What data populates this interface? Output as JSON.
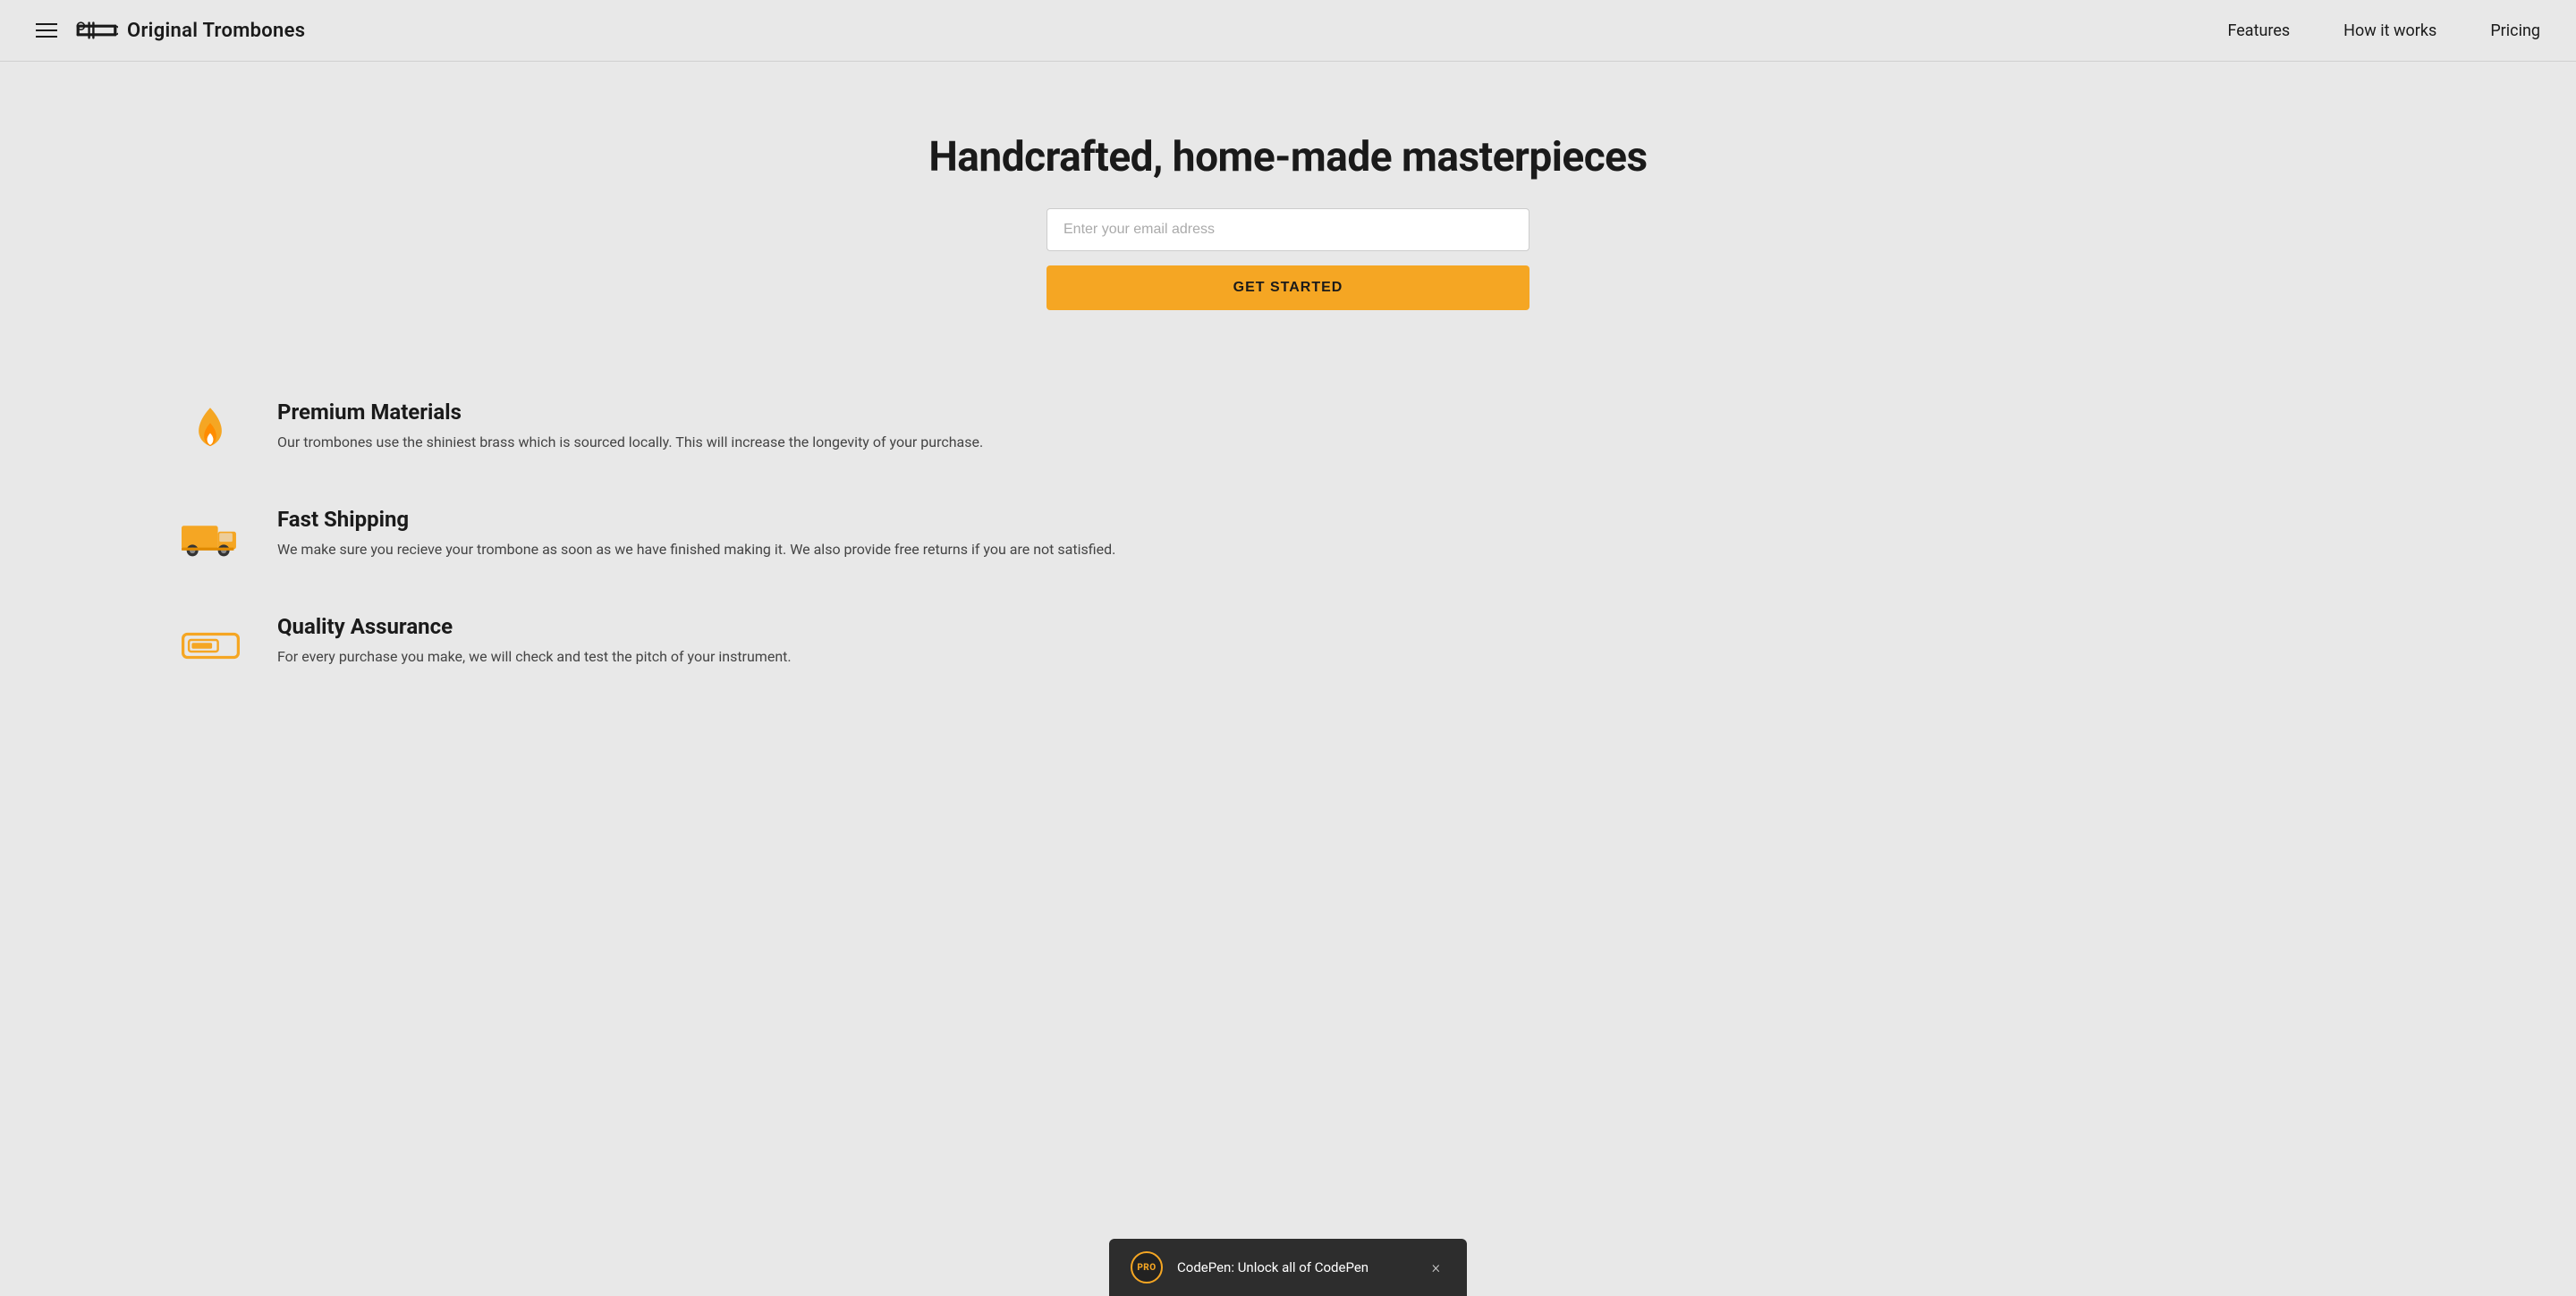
{
  "header": {
    "hamburger_label": "menu",
    "logo_text": "Original Trombones",
    "nav_items": [
      {
        "label": "Features",
        "href": "#features"
      },
      {
        "label": "How it works",
        "href": "#how-it-works"
      },
      {
        "label": "Pricing",
        "href": "#pricing"
      }
    ]
  },
  "hero": {
    "title": "Handcrafted, home-made masterpieces",
    "email_placeholder": "Enter your email adress",
    "cta_label": "GET STARTED"
  },
  "features": [
    {
      "icon": "flame-icon",
      "title": "Premium Materials",
      "description": "Our trombones use the shiniest brass which is sourced locally. This will increase the longevity of your purchase."
    },
    {
      "icon": "truck-icon",
      "title": "Fast Shipping",
      "description": "We make sure you recieve your trombone as soon as we have finished making it. We also provide free returns if you are not satisfied."
    },
    {
      "icon": "quality-icon",
      "title": "Quality Assurance",
      "description": "For every purchase you make, we will check and test the pitch of your instrument."
    }
  ],
  "codepen_banner": {
    "badge_text": "PRO",
    "message": "CodePen: Unlock all of CodePen",
    "close_label": "×"
  },
  "colors": {
    "accent": "#f5a623",
    "background": "#e8e8e8",
    "text_primary": "#1a1a1a",
    "text_secondary": "#444"
  }
}
